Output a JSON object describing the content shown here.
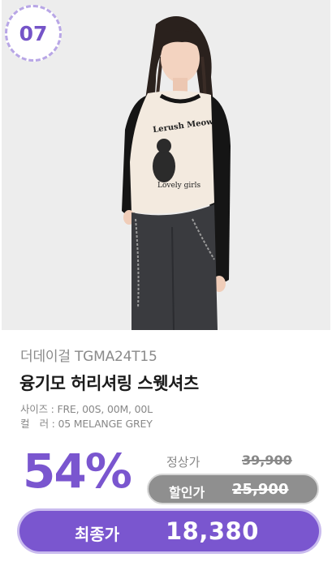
{
  "badge": {
    "rank": "07"
  },
  "product": {
    "brand_code": "더데이걸 TGMA24T15",
    "name": "융기모 허리셔링 스웻셔츠",
    "size_line": "사이즈 : FRE, 00S, 00M, 00L",
    "color_line": "컬　러 : 05 MELANGE GREY",
    "shirt_print_top": "Lerush Meow",
    "shirt_print_bottom": "Lovely girls"
  },
  "pricing": {
    "discount": "54%",
    "regular_label": "정상가",
    "regular_price": "39,900",
    "sale_label": "할인가",
    "sale_price": "25,900",
    "final_label": "최종가",
    "final_price": "18,380"
  },
  "colors": {
    "accent": "#7a56cf",
    "badge_border": "#b8a6e6",
    "sale_pill": "#8f8f8f"
  }
}
